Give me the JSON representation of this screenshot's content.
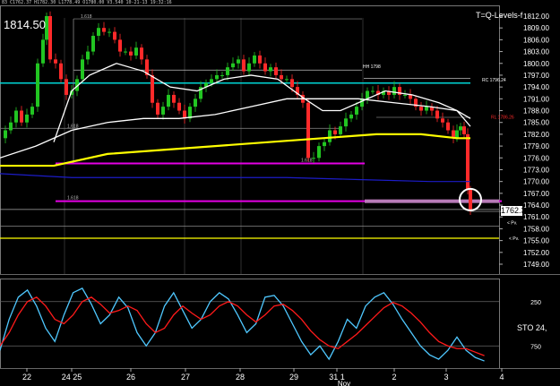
{
  "header": {
    "ohlc_text": "83 C1762.37 H1782.30 L1778.49 O1780.00 V3.540 10-21-13 19:32:16",
    "last_price": "1814.50",
    "levels_title": "T=Q-Levels-f",
    "current_price_box": "1762.37",
    "oscillator_title": "STO 24,"
  },
  "chart_data": {
    "type": "line",
    "price_axis": {
      "ylim": [
        1746.5,
        1814.5
      ],
      "ticks": [
        "1812.00",
        "1809.00",
        "1806.00",
        "1803.00",
        "1800.00",
        "1797.00",
        "1794.00",
        "1791.00",
        "1788.00",
        "1785.00",
        "1782.00",
        "1779.00",
        "1776.00",
        "1773.00",
        "1770.00",
        "1767.00",
        "1764.00",
        "1761.00",
        "1758.00",
        "1755.00",
        "1752.00",
        "1749.00"
      ]
    },
    "x_axis": {
      "ticks": [
        "22",
        "24 25",
        "26",
        "27",
        "28",
        "29",
        "31 1",
        "2",
        "3",
        "4"
      ],
      "sublabel": "Nov"
    },
    "oscillator_axis": {
      "ylim": [
        0,
        100
      ],
      "ticks": [
        "250",
        "750"
      ]
    },
    "colors": {
      "candle_up": "#22c522",
      "candle_down": "#ff2a2a",
      "ma_fast": "#ffffff",
      "ma_medium": "#ffffff",
      "ma_slow": "#ffff00",
      "ma_very_slow": "#1c1cc8",
      "level_cyan": "#00d5d5",
      "level_magenta": "#e400e4",
      "level_yellow": "#ffff00",
      "sto_k": "#4fc8ff",
      "sto_d": "#ff1a1a"
    },
    "annotations": {
      "level_a": "1.618",
      "level_b": "1.618",
      "level_c": "1.618",
      "level_d": "1.618",
      "hh_label": "HH 1798",
      "right_tag_a": "RC 1796.24",
      "right_tag_b": "RL 1786.26",
      "right_tag_c": "<",
      "right_tag_d": "< Pv.",
      "right_tag_e": "< Pv."
    },
    "levels": [
      {
        "y": 1795.0,
        "color": "level_cyan"
      },
      {
        "y": 1797.8,
        "color": "level_magenta"
      },
      {
        "y": 1774.5,
        "color": "level_magenta"
      },
      {
        "y": 1765.0,
        "color": "level_magenta"
      },
      {
        "y": 1755.5,
        "color": "level_yellow"
      },
      {
        "y": 1758.7,
        "color": "level_yellow"
      },
      {
        "y": 1762.9,
        "color": "level_magenta"
      }
    ],
    "sto_levels": [
      25,
      75
    ]
  }
}
